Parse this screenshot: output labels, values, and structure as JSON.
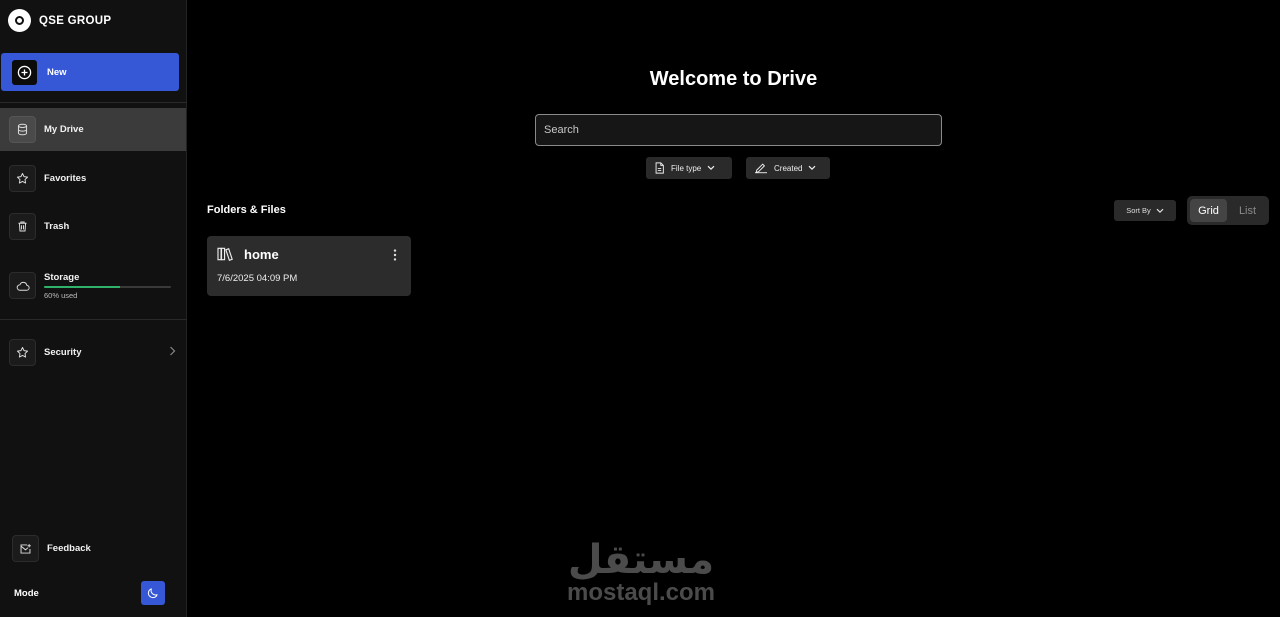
{
  "brand": {
    "name": "QSE GROUP"
  },
  "sidebar": {
    "new_label": "New",
    "items": [
      {
        "label": "My Drive",
        "icon": "database-icon",
        "active": true
      },
      {
        "label": "Favorites",
        "icon": "star-icon"
      },
      {
        "label": "Trash",
        "icon": "trash-icon"
      }
    ],
    "storage": {
      "label": "Storage",
      "used_text": "60% used",
      "used_fraction": 0.6
    },
    "security_label": "Security",
    "feedback_label": "Feedback",
    "mode_label": "Mode"
  },
  "main": {
    "title": "Welcome to Drive",
    "search_placeholder": "Search",
    "filters": [
      {
        "label": "File type"
      },
      {
        "label": "Created"
      }
    ],
    "section_title": "Folders & Files",
    "sort_label": "Sort By",
    "view_options": [
      "Grid",
      "List"
    ],
    "selected_view": "Grid",
    "files": [
      {
        "name": "home",
        "date": "7/6/2025 04:09 PM"
      }
    ]
  },
  "watermark": {
    "arabic": "مستقل",
    "latin": "mostaql.com"
  },
  "colors": {
    "accent": "#3657d6",
    "storage": "#2fb36b",
    "background": "#000000",
    "sidebar": "#111111"
  }
}
